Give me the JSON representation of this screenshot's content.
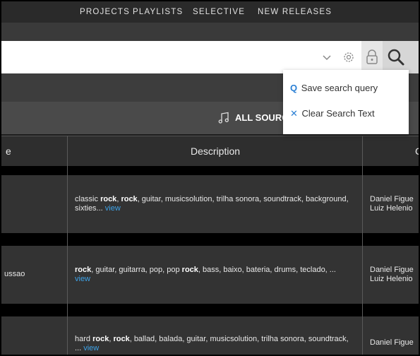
{
  "nav": [
    "PROJECTS",
    "PLAYLISTS",
    "SELECTIVE",
    "NEW RELEASES"
  ],
  "search": {
    "value": "",
    "placeholder": ""
  },
  "icons": {
    "chevron": "chevron-down-icon",
    "settings": "gear-icon",
    "lock": "lock-icon",
    "search": "search-icon",
    "music": "music-note-icon"
  },
  "colors": {
    "link": "#3ea3e8",
    "accent": "#2a7fd4"
  },
  "sources_label": "ALL SOURC",
  "table": {
    "headers": [
      "e",
      "Description",
      "C"
    ],
    "rows": [
      {
        "col1": "",
        "desc_html": "classic <b>rock</b>, <b>rock</b>, guitar, musicsolution, trilha sonora, soundtrack, background, sixties...",
        "view": "view",
        "creators": [
          "Daniel Figue",
          "Luiz Helenio"
        ]
      },
      {
        "col1": "ussao",
        "desc_html": "<b>rock</b>, guitar, guitarra, pop, pop <b>rock</b>, bass, baixo, bateria, drums, teclado, ...",
        "view": "view",
        "creators": [
          "Daniel Figue",
          "Luiz Helenio"
        ]
      },
      {
        "col1": "",
        "desc_html": "hard <b>rock</b>, <b>rock</b>, ballad, balada, guitar, musicsolution, trilha sonora, soundtrack, ...",
        "view": "view",
        "creators": [
          "Daniel Figue"
        ]
      }
    ]
  },
  "dropdown": {
    "save": {
      "icon": "Q",
      "label": "Save search query"
    },
    "clear": {
      "icon": "✕",
      "label": "Clear Search Text"
    }
  }
}
